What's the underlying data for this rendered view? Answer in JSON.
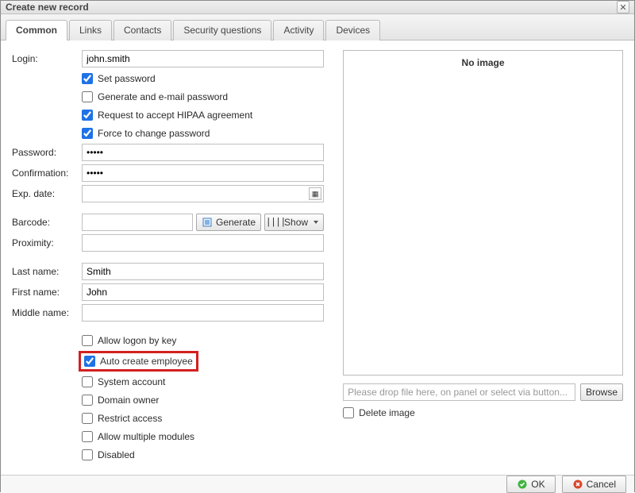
{
  "window": {
    "title": "Create new record"
  },
  "tabs": {
    "common": "Common",
    "links": "Links",
    "contacts": "Contacts",
    "security": "Security questions",
    "activity": "Activity",
    "devices": "Devices"
  },
  "labels": {
    "login": "Login:",
    "password": "Password:",
    "confirmation": "Confirmation:",
    "exp_date": "Exp. date:",
    "barcode": "Barcode:",
    "proximity": "Proximity:",
    "last_name": "Last name:",
    "first_name": "First name:",
    "middle_name": "Middle name:"
  },
  "fields": {
    "login": "john.smith",
    "password": "•••••",
    "confirmation": "•••••",
    "exp_date": "",
    "barcode": "",
    "proximity": "",
    "last_name": "Smith",
    "first_name": "John",
    "middle_name": ""
  },
  "checks": {
    "set_password": {
      "label": "Set password",
      "checked": true
    },
    "gen_email_password": {
      "label": "Generate and e-mail password",
      "checked": false
    },
    "hipaa": {
      "label": "Request to accept HIPAA agreement",
      "checked": true
    },
    "force_change": {
      "label": "Force to change password",
      "checked": true
    },
    "allow_logon_key": {
      "label": "Allow logon by key",
      "checked": false
    },
    "auto_create_employee": {
      "label": "Auto create employee",
      "checked": true
    },
    "system_account": {
      "label": "System account",
      "checked": false
    },
    "domain_owner": {
      "label": "Domain owner",
      "checked": false
    },
    "restrict_access": {
      "label": "Restrict access",
      "checked": false
    },
    "allow_multiple_modules": {
      "label": "Allow multiple modules",
      "checked": false
    },
    "disabled": {
      "label": "Disabled",
      "checked": false
    }
  },
  "buttons": {
    "generate": "Generate",
    "show": "Show",
    "browse": "Browse",
    "ok": "OK",
    "cancel": "Cancel"
  },
  "image_panel": {
    "no_image": "No image",
    "drop_placeholder": "Please drop file here, on panel or select via button...",
    "delete_image": "Delete image"
  }
}
